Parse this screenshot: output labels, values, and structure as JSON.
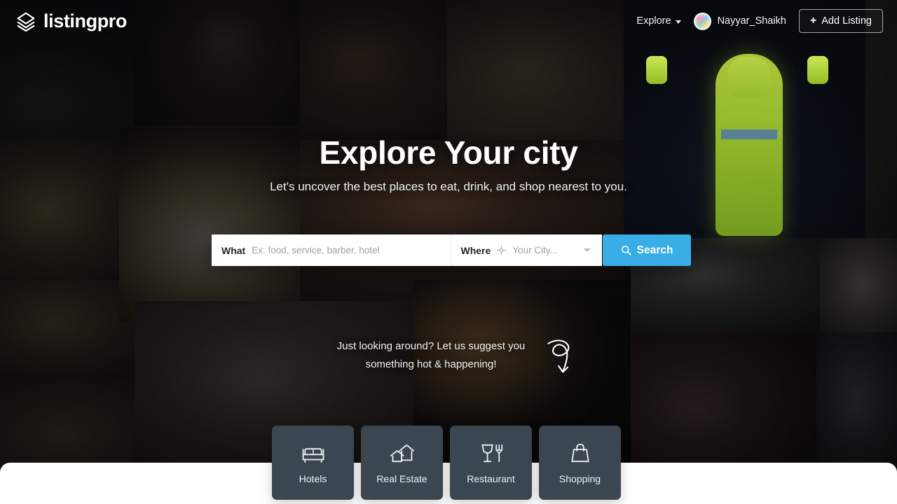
{
  "header": {
    "brand_name": "listingpro",
    "brand_icon": "layers-stack-icon",
    "explore_label": "Explore",
    "explore_caret_icon": "chevron-down-icon",
    "avatar_icon": "user-avatar",
    "user_name": "Nayyar_Shaikh",
    "add_listing_label": "Add Listing",
    "add_listing_icon": "plus-icon"
  },
  "hero": {
    "title": "Explore Your city",
    "subtitle": "Let's uncover the best places to eat, drink, and shop nearest to you."
  },
  "search": {
    "what_label": "What",
    "what_placeholder": "Ex: food, service, barber, hotel",
    "what_value": "",
    "where_label": "Where",
    "where_icon": "locate-crosshair-icon",
    "where_placeholder": "Your City...",
    "where_value": "",
    "where_caret_icon": "chevron-down-icon",
    "search_button_label": "Search",
    "search_button_icon": "search-icon",
    "search_button_color": "#38ade6"
  },
  "suggest": {
    "line1": "Just looking around? Let us suggest you",
    "line2": "something hot & happening!",
    "arrow_icon": "curved-arrow-down-icon"
  },
  "categories": [
    {
      "label": "Hotels",
      "icon": "bed-icon"
    },
    {
      "label": "Real Estate",
      "icon": "house-icon"
    },
    {
      "label": "Restaurant",
      "icon": "wineglass-fork-icon"
    },
    {
      "label": "Shopping",
      "icon": "shopping-bag-icon"
    }
  ],
  "colors": {
    "card_background": "#3c4650",
    "accent_blue": "#38ade6",
    "panel_white": "#ffffff",
    "text_light": "#ffffff"
  }
}
